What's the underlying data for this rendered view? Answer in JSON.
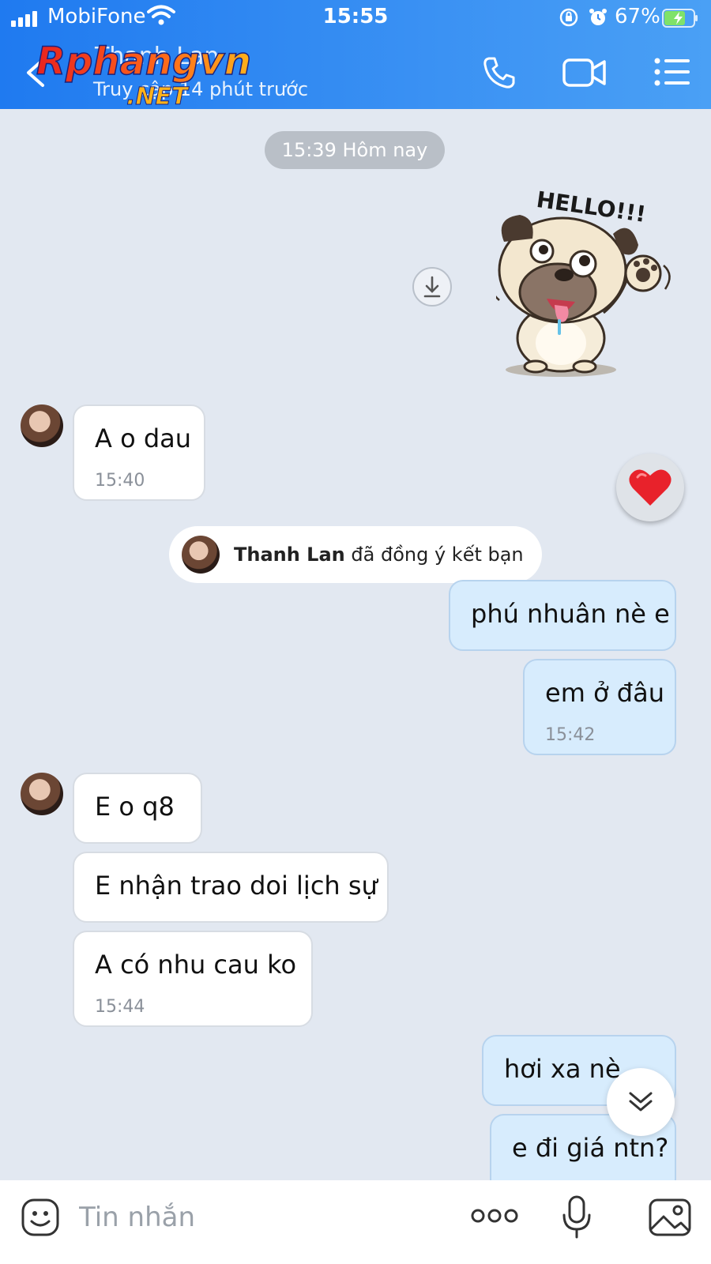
{
  "status_bar": {
    "carrier": "MobiFone",
    "time": "15:55",
    "battery_percent": "67%"
  },
  "header": {
    "contact_name": "Thanh Lan",
    "last_seen": "Truy cập 14 phút trước",
    "watermark_main": "Rphangvn",
    "watermark_sub": ".NET",
    "icons": [
      "back-icon",
      "phone-icon",
      "video-camera-icon",
      "menu-list-icon"
    ]
  },
  "chat": {
    "date_divider": "15:39 Hôm nay",
    "sticker": {
      "text": "HELLO!!!"
    },
    "friend_notice": {
      "name": "Thanh Lan",
      "action": " đã đồng ý kết bạn"
    },
    "messages": [
      {
        "dir": "in",
        "text": "A o dau",
        "time": "15:40"
      },
      {
        "dir": "out",
        "text": "phú nhuân nè e",
        "time": ""
      },
      {
        "dir": "out",
        "text": "em ở đâu",
        "time": "15:42"
      },
      {
        "dir": "in",
        "text": "E o q8",
        "time": ""
      },
      {
        "dir": "in",
        "text": "E nhận trao doi lịch sự",
        "time": ""
      },
      {
        "dir": "in",
        "text": "A có nhu cau ko",
        "time": "15:44"
      },
      {
        "dir": "out",
        "text": "hơi xa nè",
        "time": ""
      },
      {
        "dir": "out",
        "text": "e đi giá ntn?",
        "time": ""
      }
    ],
    "reaction": "heart-icon"
  },
  "input_bar": {
    "placeholder": "Tin nhắn",
    "icons": [
      "emoji-icon",
      "more-dots-icon",
      "microphone-icon",
      "image-icon"
    ]
  },
  "colors": {
    "header_blue": "#2f87f2",
    "chat_background": "#e2e8f1",
    "outgoing_bubble": "#d7ecfd",
    "incoming_bubble": "#ffffff"
  }
}
